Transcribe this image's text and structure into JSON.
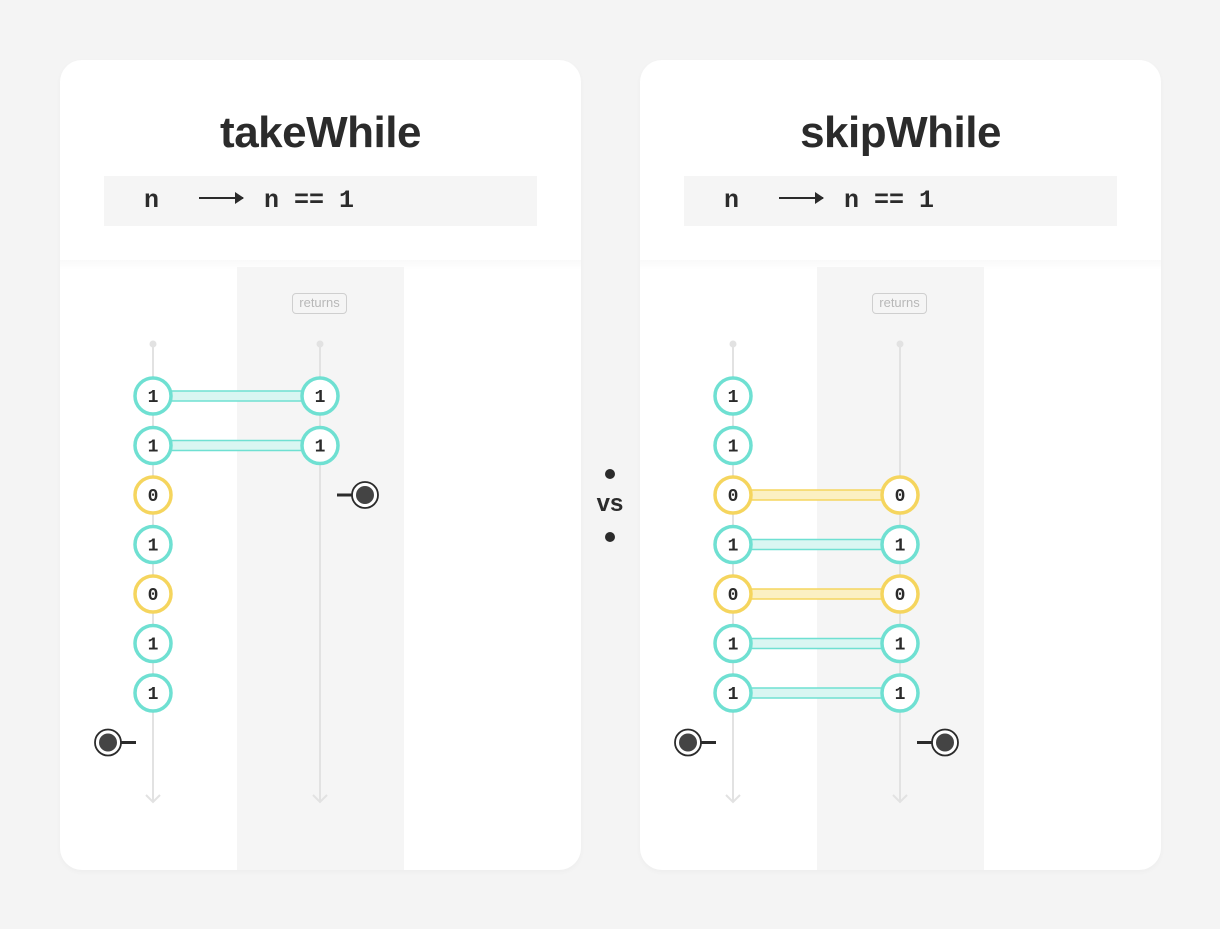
{
  "panels": [
    {
      "title": "takeWhile",
      "predicate": {
        "param": "n",
        "body": "n == 1"
      },
      "output_label": "returns",
      "input": [
        1,
        1,
        0,
        1,
        0,
        1,
        1
      ],
      "output": [
        {
          "from_index": 0,
          "value": 1
        },
        {
          "from_index": 1,
          "value": 1
        }
      ],
      "input_completes_after": 7,
      "output_completes_after": 2
    },
    {
      "title": "skipWhile",
      "predicate": {
        "param": "n",
        "body": "n == 1"
      },
      "output_label": "returns",
      "input": [
        1,
        1,
        0,
        1,
        0,
        1,
        1
      ],
      "output": [
        {
          "from_index": 2,
          "value": 0
        },
        {
          "from_index": 3,
          "value": 1
        },
        {
          "from_index": 4,
          "value": 0
        },
        {
          "from_index": 5,
          "value": 1
        },
        {
          "from_index": 6,
          "value": 1
        }
      ],
      "input_completes_after": 7,
      "output_completes_after": 7
    }
  ],
  "separator": {
    "label": "vs"
  },
  "colors": {
    "value_1": "#6fe0d2",
    "value_1_link": "#d9f6f2",
    "value_0": "#f5d55e",
    "value_0_link": "#fbf0c3",
    "text": "#2b2b2b",
    "timeline": "#e2e2e2"
  }
}
